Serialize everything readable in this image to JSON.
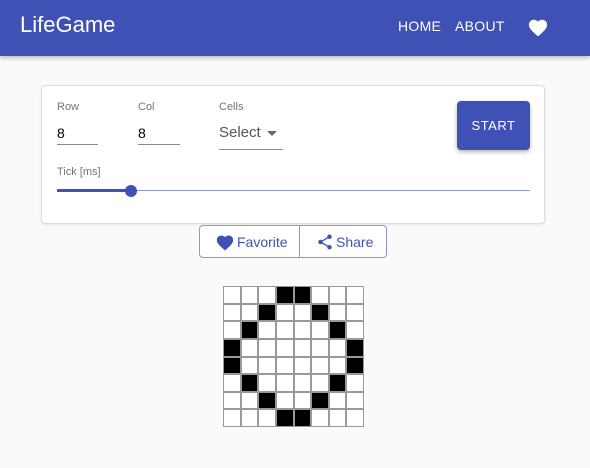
{
  "header": {
    "title": "LifeGame",
    "nav": [
      "HOME",
      "ABOUT"
    ],
    "icon": "heart-icon"
  },
  "controls": {
    "row_label": "Row",
    "row_value": "8",
    "col_label": "Col",
    "col_value": "8",
    "cells_label": "Cells",
    "cells_value": "Select",
    "start_label": "START",
    "tick_label": "Tick [ms]",
    "tick_fraction": 0.156
  },
  "actions": {
    "favorite_label": "Favorite",
    "share_label": "Share"
  },
  "board": {
    "rows": 8,
    "cols": 8,
    "alive": [
      [
        0,
        0,
        0,
        1,
        1,
        0,
        0,
        0
      ],
      [
        0,
        0,
        1,
        0,
        0,
        1,
        0,
        0
      ],
      [
        0,
        1,
        0,
        0,
        0,
        0,
        1,
        0
      ],
      [
        1,
        0,
        0,
        0,
        0,
        0,
        0,
        1
      ],
      [
        1,
        0,
        0,
        0,
        0,
        0,
        0,
        1
      ],
      [
        0,
        1,
        0,
        0,
        0,
        0,
        1,
        0
      ],
      [
        0,
        0,
        1,
        0,
        0,
        1,
        0,
        0
      ],
      [
        0,
        0,
        0,
        1,
        1,
        0,
        0,
        0
      ]
    ]
  },
  "colors": {
    "primary": "#3f51b5",
    "background": "#fafafa",
    "alive": "#000000"
  }
}
